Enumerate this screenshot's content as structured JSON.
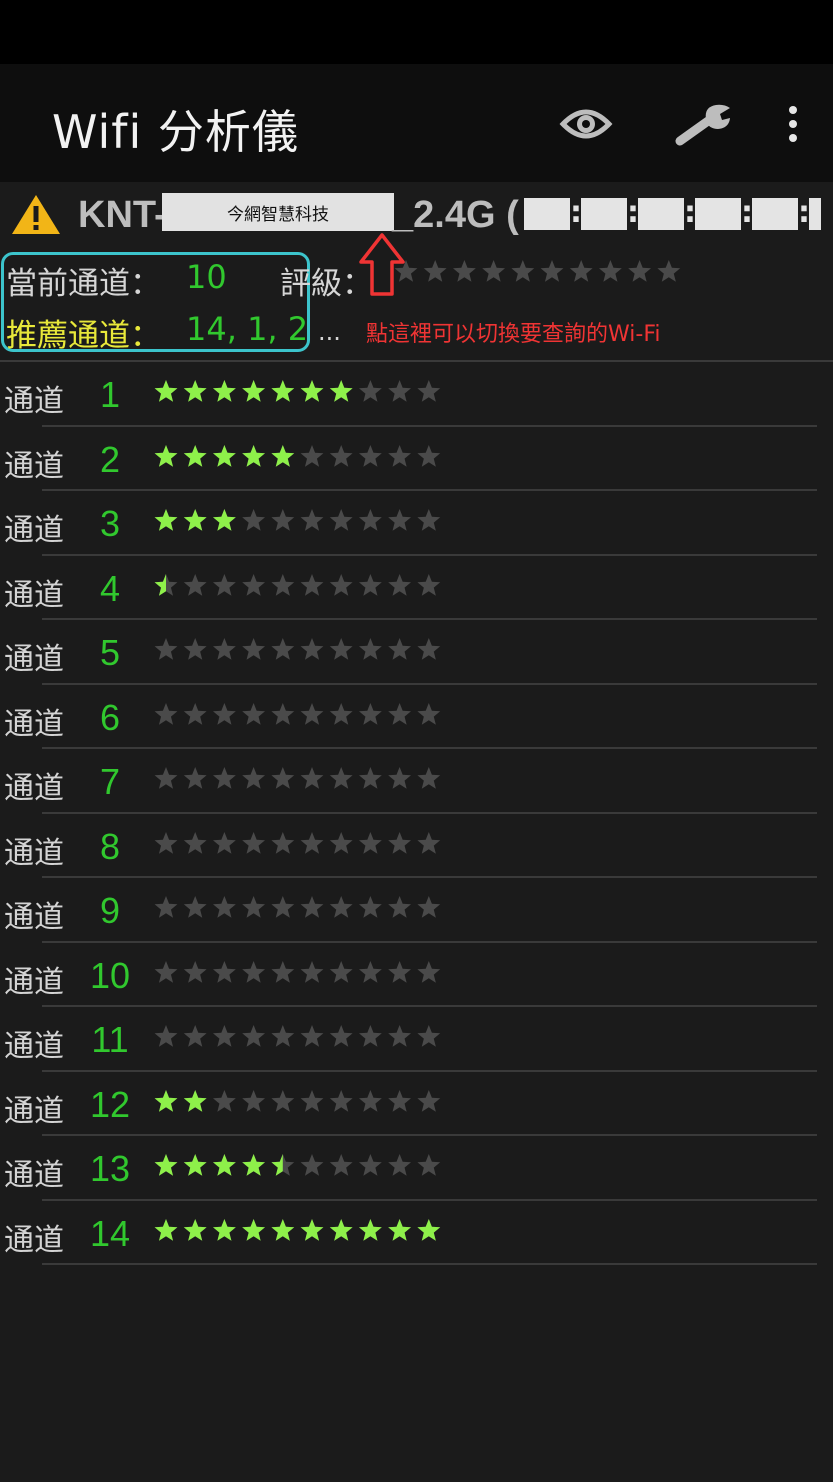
{
  "app": {
    "title": "Wifi 分析儀",
    "actions": {
      "view_icon": "eye-icon",
      "tools_icon": "wrench-icon",
      "more_icon": "more-vert-icon"
    }
  },
  "network": {
    "ssid_prefix": "KNT-",
    "ssid_mask_text": "今網智慧科技",
    "ssid_suffix": "_2.4G (",
    "warning_icon": "warning-icon"
  },
  "info": {
    "current_label": "當前通道：",
    "current_value": "10",
    "rating_label": "評級：",
    "rating_stars": 0,
    "recommended_label": "推薦通道：",
    "recommended_value": "14, 1, 2",
    "ellipsis": "...",
    "hint": "點這裡可以切換要查詢的Wi-Fi"
  },
  "channel_label": "通道",
  "max_stars": 10,
  "colors": {
    "accent_green": "#31c82e",
    "star_on": "#8ef04a",
    "star_off": "#4a4a4a",
    "highlight_box": "#3cc4cc",
    "hint_red": "#f03434",
    "recommend_yellow": "#e8e83a"
  },
  "channels": [
    {
      "num": "1",
      "stars": 7
    },
    {
      "num": "2",
      "stars": 5
    },
    {
      "num": "3",
      "stars": 3
    },
    {
      "num": "4",
      "stars": 0.5
    },
    {
      "num": "5",
      "stars": 0
    },
    {
      "num": "6",
      "stars": 0
    },
    {
      "num": "7",
      "stars": 0
    },
    {
      "num": "8",
      "stars": 0
    },
    {
      "num": "9",
      "stars": 0
    },
    {
      "num": "10",
      "stars": 0
    },
    {
      "num": "11",
      "stars": 0
    },
    {
      "num": "12",
      "stars": 2
    },
    {
      "num": "13",
      "stars": 4.5
    },
    {
      "num": "14",
      "stars": 10
    }
  ]
}
